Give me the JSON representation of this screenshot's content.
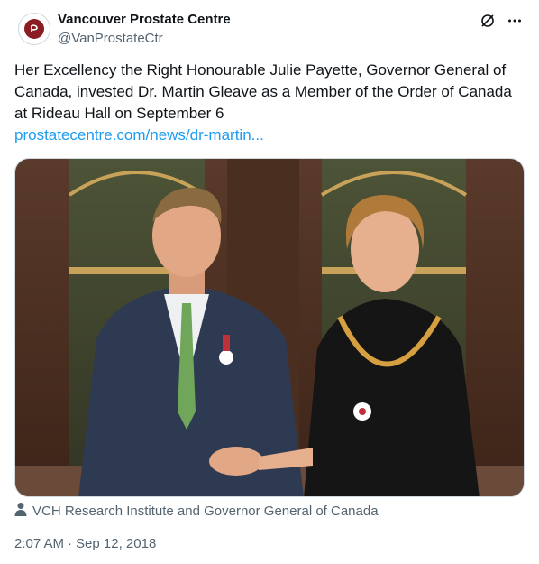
{
  "author": {
    "display_name": "Vancouver Prostate Centre",
    "handle": "@VanProstateCtr"
  },
  "tweet": {
    "text": "Her Excellency the Right Honourable Julie Payette, Governor General of Canada, invested Dr. Martin Gleave as a Member of the Order of Canada at Rideau Hall on September 6",
    "link": "prostatecentre.com/news/dr-martin..."
  },
  "media": {
    "caption": "VCH Research Institute and Governor General of Canada"
  },
  "meta": {
    "time": "2:07 AM",
    "separator": "·",
    "date": "Sep 12, 2018"
  },
  "icons": {
    "grok": "grok-icon",
    "more": "more-icon",
    "person": "person-icon"
  },
  "colors": {
    "link": "#1d9bf0",
    "secondary_text": "#536471",
    "primary_text": "#0f1419",
    "logo": "#8a1c24"
  }
}
